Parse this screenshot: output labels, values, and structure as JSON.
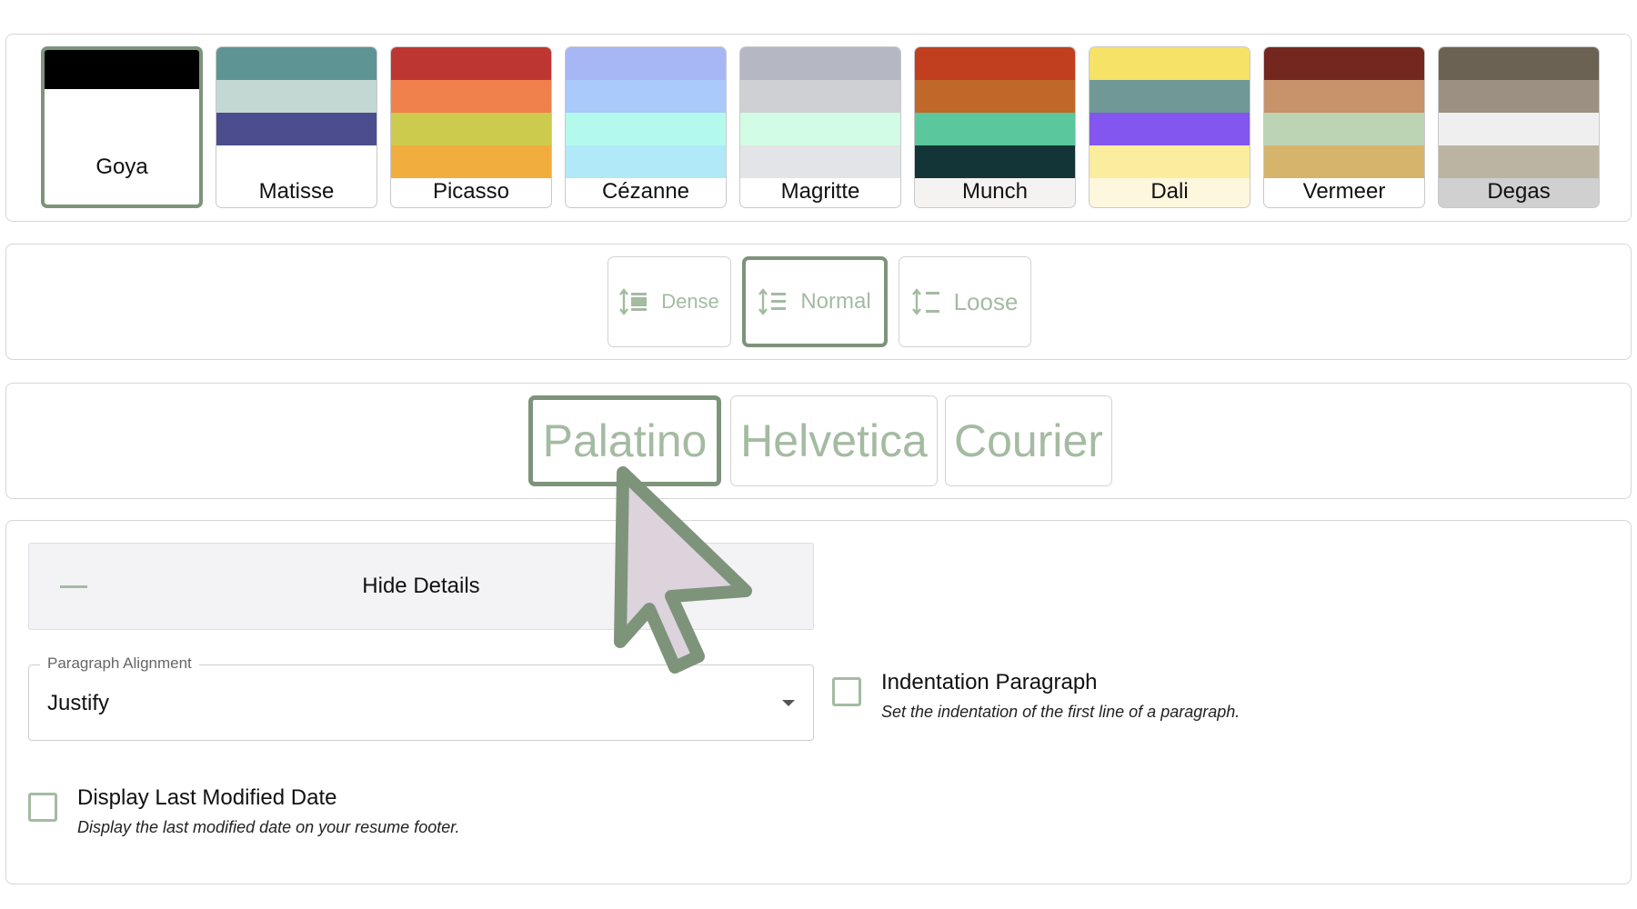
{
  "palettes": [
    {
      "name": "Goya",
      "selected": true,
      "colors": [
        "#000000"
      ]
    },
    {
      "name": "Matisse",
      "selected": false,
      "colors": [
        "#5e9594",
        "#c3d8d3",
        "#4b4d8e",
        "#ffffff"
      ]
    },
    {
      "name": "Picasso",
      "selected": false,
      "colors": [
        "#be3632",
        "#f0804c",
        "#cdcb4e",
        "#f2ad3f"
      ]
    },
    {
      "name": "Cézanne",
      "selected": false,
      "colors": [
        "#a7b7f5",
        "#a9cafa",
        "#b3faec",
        "#b1e9f8"
      ]
    },
    {
      "name": "Magritte",
      "selected": false,
      "colors": [
        "#b5b8c3",
        "#cfd0d4",
        "#d3fce6",
        "#e2e4e7"
      ]
    },
    {
      "name": "Munch",
      "selected": false,
      "colors": [
        "#c13e1f",
        "#c0672a",
        "#5ac89c",
        "#133537"
      ]
    },
    {
      "name": "Dali",
      "selected": false,
      "colors": [
        "#f6e267",
        "#6f9896",
        "#8256ef",
        "#fbed9d"
      ]
    },
    {
      "name": "Vermeer",
      "selected": false,
      "colors": [
        "#74271f",
        "#c8926a",
        "#bdd4b4",
        "#d6b46b"
      ]
    },
    {
      "name": "Degas",
      "selected": false,
      "colors": [
        "#6b6254",
        "#9b9082",
        "#efefef",
        "#bcb4a3"
      ]
    }
  ],
  "palette_footer_colors": [
    "#ffffff",
    "#ffffff",
    "#ffffff",
    "#ffffff",
    "#ffffff",
    "#f5f3f1",
    "#fdf7dd",
    "#ffffff",
    "#d0d0d0"
  ],
  "spacing": {
    "options": [
      {
        "label": "Dense",
        "icon": "dense-spacing-icon",
        "selected": false
      },
      {
        "label": "Normal",
        "icon": "normal-spacing-icon",
        "selected": true
      },
      {
        "label": "Loose",
        "icon": "loose-spacing-icon",
        "selected": false
      }
    ]
  },
  "fonts": {
    "options": [
      {
        "label": "Palatino",
        "selected": true
      },
      {
        "label": "Helvetica",
        "selected": false
      },
      {
        "label": "Courier",
        "selected": false
      }
    ]
  },
  "details": {
    "toggle_label": "Hide Details",
    "icon": "minus-icon"
  },
  "alignment": {
    "legend": "Paragraph Alignment",
    "value": "Justify"
  },
  "indentation": {
    "title": "Indentation Paragraph",
    "description": "Set the indentation of the first line of a paragraph.",
    "checked": false
  },
  "modified_date": {
    "title": "Display Last Modified Date",
    "description": "Display the last modified date on your resume footer.",
    "checked": false
  },
  "accent_color": "#7d947b",
  "muted_green": "#a4bba2"
}
